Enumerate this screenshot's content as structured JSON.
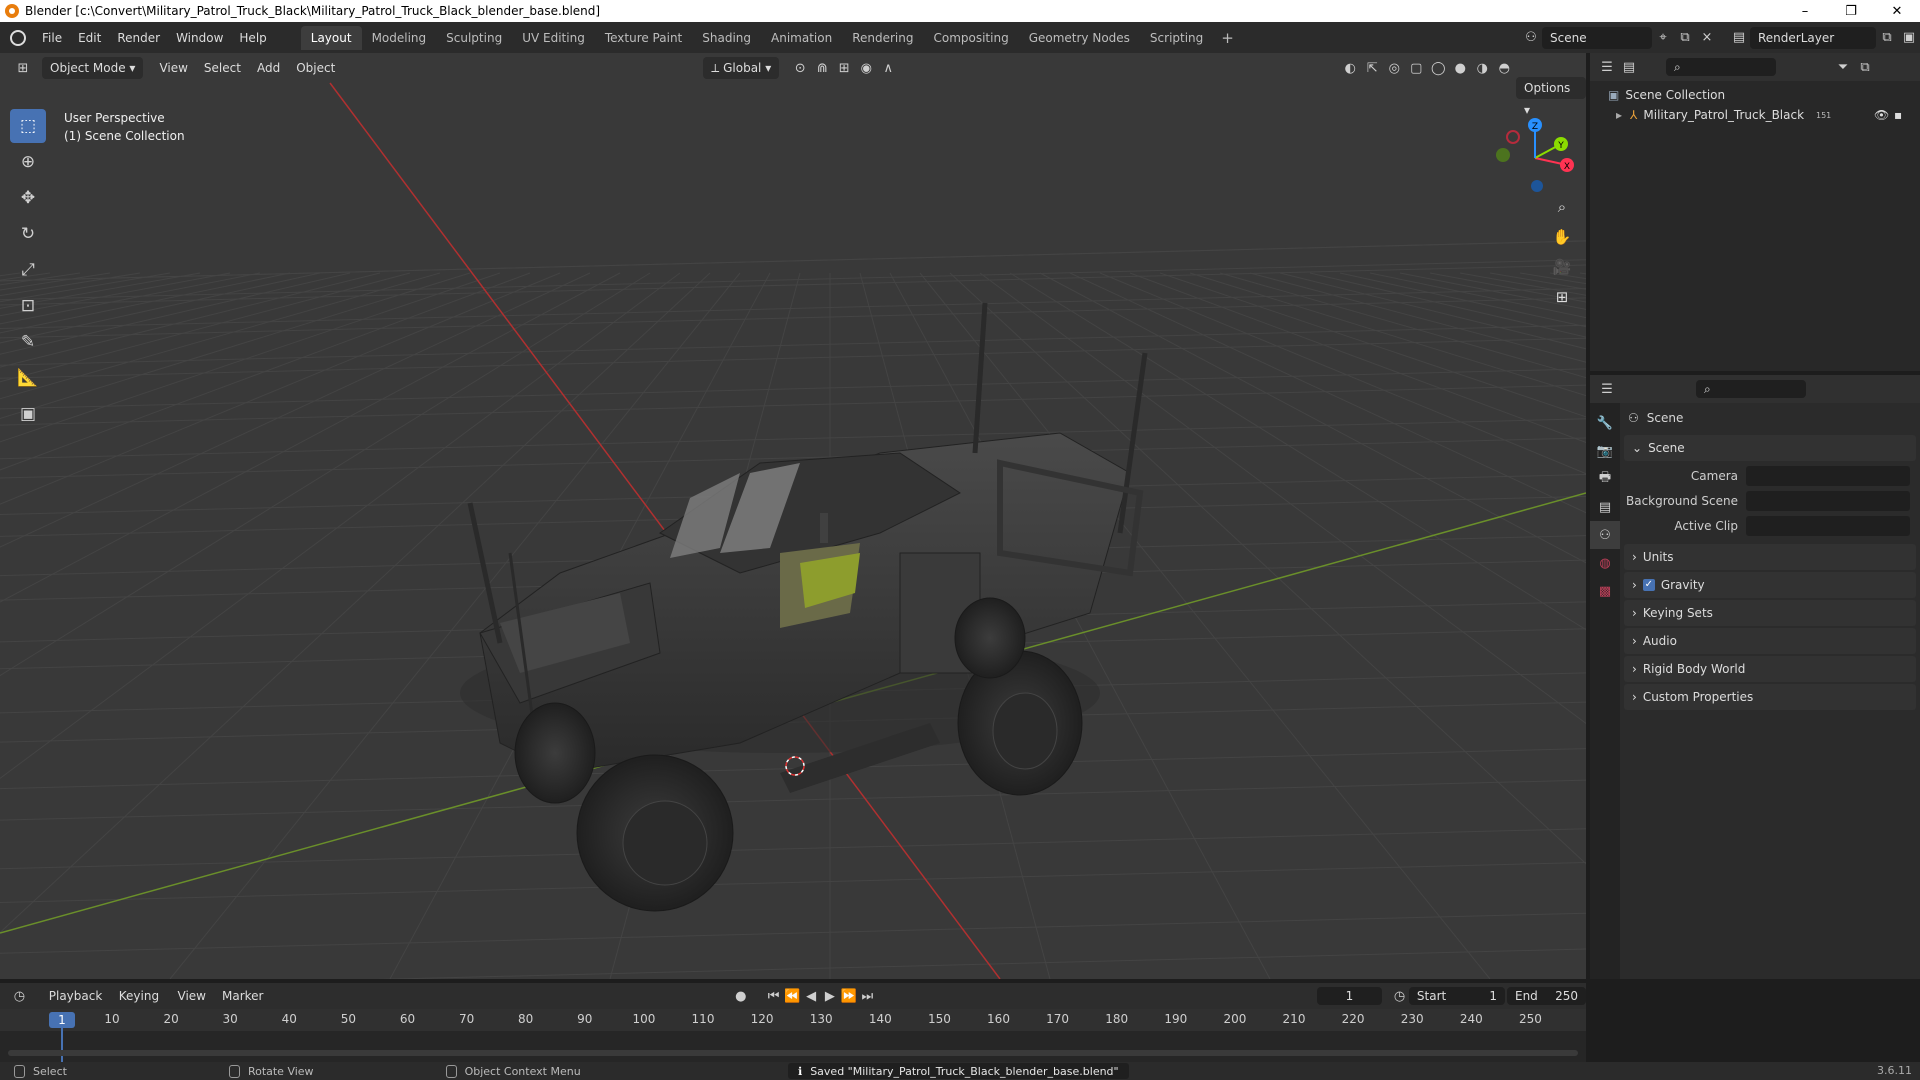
{
  "window": {
    "title": "Blender [c:\\Convert\\Military_Patrol_Truck_Black\\Military_Patrol_Truck_Black_blender_base.blend]",
    "controls": [
      "–",
      "❐",
      "✕"
    ]
  },
  "menubar": {
    "menus": [
      "File",
      "Edit",
      "Render",
      "Window",
      "Help"
    ],
    "workspaces": [
      "Layout",
      "Modeling",
      "Sculpting",
      "UV Editing",
      "Texture Paint",
      "Shading",
      "Animation",
      "Rendering",
      "Compositing",
      "Geometry Nodes",
      "Scripting"
    ],
    "active_workspace": "Layout",
    "add_workspace": "+",
    "scene": "Scene",
    "view_layer": "RenderLayer"
  },
  "viewport": {
    "mode": "Object Mode",
    "menus": [
      "View",
      "Select",
      "Add",
      "Object"
    ],
    "transform_orientation": "Global",
    "options_label": "Options",
    "overlay_line1": "User Perspective",
    "overlay_line2": "(1) Scene Collection",
    "gizmo": {
      "x": "X",
      "y": "Y",
      "z": "Z",
      "x_color": "#ff3352",
      "y_color": "#8bdc00",
      "z_color": "#2890ff"
    },
    "tools": [
      "select-box-icon",
      "cursor-icon",
      "move-icon",
      "rotate-icon",
      "scale-icon",
      "transform-icon",
      "annotate-icon",
      "measure-icon",
      "add-cube-icon"
    ],
    "nav_tools": [
      "zoom-icon",
      "pan-hand-icon",
      "camera-view-icon",
      "ortho-grid-icon"
    ]
  },
  "outliner": {
    "root": "Scene Collection",
    "items": [
      {
        "name": "Military_Patrol_Truck_Black",
        "badge": "151"
      }
    ]
  },
  "properties": {
    "context": "Scene",
    "section": "Scene",
    "fields": [
      {
        "label": "Camera",
        "value": ""
      },
      {
        "label": "Background Scene",
        "value": ""
      },
      {
        "label": "Active Clip",
        "value": ""
      }
    ],
    "panels": [
      "Units",
      "Gravity",
      "Keying Sets",
      "Audio",
      "Rigid Body World",
      "Custom Properties"
    ],
    "gravity_checked": true
  },
  "timeline": {
    "menus": [
      "Playback",
      "Keying",
      "View",
      "Marker"
    ],
    "current_frame": "1",
    "start_label": "Start",
    "start": "1",
    "end_label": "End",
    "end": "250",
    "ruler": [
      "10",
      "20",
      "30",
      "40",
      "50",
      "60",
      "70",
      "80",
      "90",
      "100",
      "110",
      "120",
      "130",
      "140",
      "150",
      "160",
      "170",
      "180",
      "190",
      "200",
      "210",
      "220",
      "230",
      "240",
      "250"
    ]
  },
  "statusbar": {
    "select": "Select",
    "rotate": "Rotate View",
    "context_menu": "Object Context Menu",
    "message": "Saved \"Military_Patrol_Truck_Black_blender_base.blend\"",
    "version": "3.6.11"
  }
}
